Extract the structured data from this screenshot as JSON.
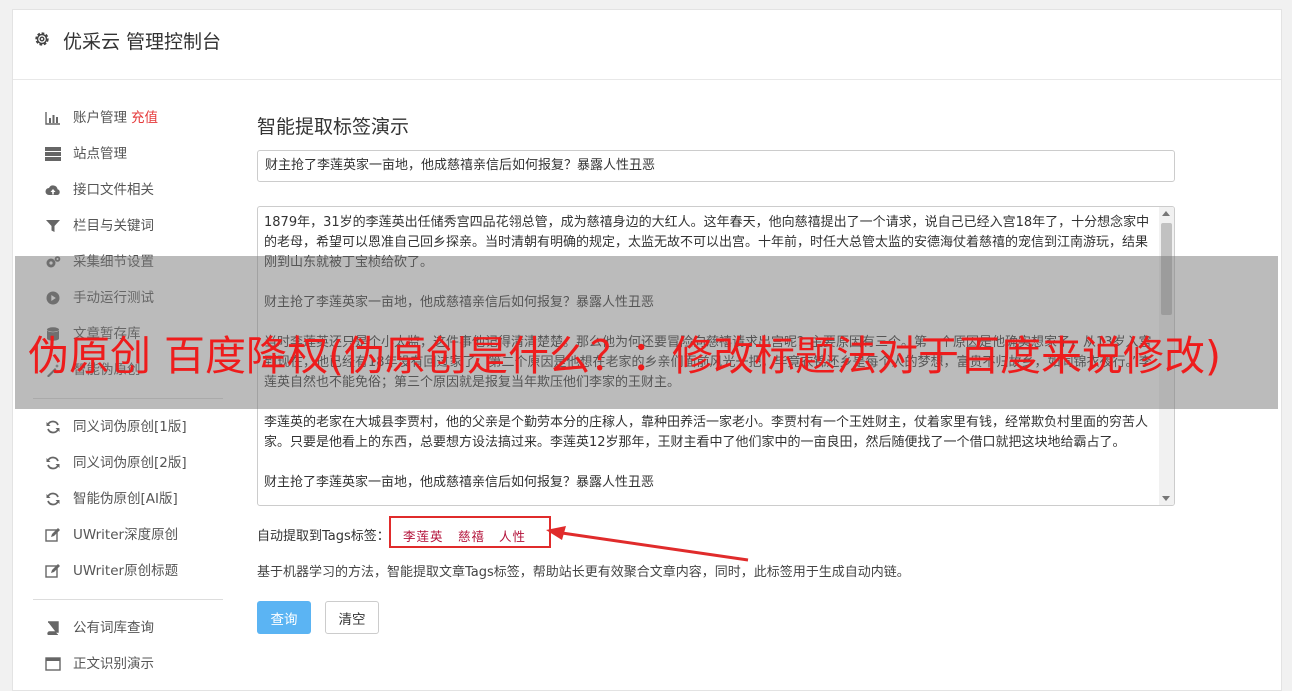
{
  "header": {
    "title": "优采云 管理控制台",
    "icon": "gear-icon"
  },
  "sidebar": {
    "items": [
      {
        "label": "账户管理",
        "badge": "充值",
        "icon": "bar-chart-icon"
      },
      {
        "label": "站点管理",
        "icon": "server-icon"
      },
      {
        "label": "接口文件相关",
        "icon": "cloud-upload-icon"
      },
      {
        "label": "栏目与关键词",
        "icon": "filter-icon"
      },
      {
        "label": "采集细节设置",
        "icon": "gears-icon"
      },
      {
        "label": "手动运行测试",
        "icon": "play-circle-icon"
      },
      {
        "label": "文章暂存库",
        "icon": "database-icon"
      },
      {
        "label": "智能伪原创",
        "icon": "magic-icon"
      }
    ],
    "items2": [
      {
        "label": "同义词伪原创[1版]",
        "icon": "refresh-icon"
      },
      {
        "label": "同义词伪原创[2版]",
        "icon": "refresh-icon"
      },
      {
        "label": "智能伪原创[AI版]",
        "icon": "refresh-icon"
      },
      {
        "label": "UWriter深度原创",
        "icon": "edit-icon"
      },
      {
        "label": "UWriter原创标题",
        "icon": "edit-icon"
      }
    ],
    "items3": [
      {
        "label": "公有词库查询",
        "icon": "book-icon"
      },
      {
        "label": "正文识别演示",
        "icon": "window-icon"
      }
    ]
  },
  "main": {
    "heading": "智能提取标签演示",
    "title_value": "财主抢了李莲英家一亩地，他成慈禧亲信后如何报复？暴露人性丑恶",
    "paragraphs": [
      "1879年，31岁的李莲英出任储秀宫四品花翎总管，成为慈禧身边的大红人。这年春天，他向慈禧提出了一个请求，说自己已经入宫18年了，十分想念家中的老母，希望可以恩准自己回乡探亲。当时清朝有明确的规定，太监无故不可以出宫。十年前，时任大总管太监的安德海仗着慈禧的宠信到江南游玩，结果刚到山东就被丁宝桢给砍了。",
      "财主抢了李莲英家一亩地，他成慈禧亲信后如何报复？暴露人性丑恶",
      "当时李莲英还只是个小太监，这件事他记得清清楚楚。那么他为何还要冒险向慈禧请求出宫呢？主要原因有三个。第一个原因是他确实想家了，从13岁入宫到现在，他已经有18年没有回过家了。第二个原因是他想在老家的乡亲们面前风光一把，毕竟衣锦还乡是每个人的梦想，富贵不归故乡，如同锦衣夜行。”李莲英自然也不能免俗；第三个原因就是报复当年欺压他们李家的王财主。",
      "李莲英的老家在大城县李贾村，他的父亲是个勤劳本分的庄稼人，靠种田养活一家老小。李贾村有一个王姓财主，仗着家里有钱，经常欺负村里面的穷苦人家。只要是他看上的东西，总要想方设法搞过来。李莲英12岁那年，王财主看中了他们家中的一亩良田，然后随便找了一个借口就把这块地给霸占了。",
      "财主抢了李莲英家一亩地，他成慈禧亲信后如何报复？暴露人性丑恶"
    ],
    "tags_label": "自动提取到Tags标签：",
    "tags": [
      "李莲英",
      "慈禧",
      "人性"
    ],
    "description": "基于机器学习的方法，智能提取文章Tags标签，帮助站长更有效聚合文章内容，同时，此标签用于生成自动内链。",
    "query_button": "查询",
    "clear_button": "清空"
  },
  "overlay": {
    "text": "伪原创 百度降权(伪原创是什么？：修改标题法对于百度来说修改)"
  },
  "colors": {
    "accent": "#5bb4f3",
    "tag": "#b3123a",
    "badge": "#e5393a",
    "overlay_text": "#ee1c1c",
    "highlight_box": "#e02b2b"
  }
}
